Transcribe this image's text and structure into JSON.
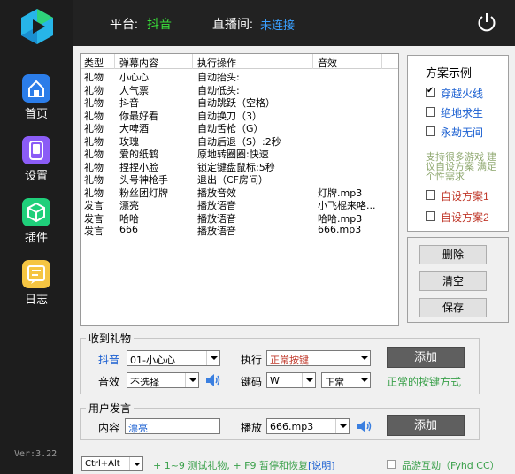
{
  "sidebar": {
    "items": [
      {
        "label": "首页",
        "icon": "home-icon",
        "color": "#2b7de9"
      },
      {
        "label": "设置",
        "icon": "settings-icon",
        "color": "#8b5cf6"
      },
      {
        "label": "插件",
        "icon": "plugin-icon",
        "color": "#1fcf7a"
      },
      {
        "label": "日志",
        "icon": "log-icon",
        "color": "#f5c542"
      }
    ],
    "version": "Ver:3.22"
  },
  "header": {
    "platform_label": "平台:",
    "platform_value": "抖音",
    "live_label": "直播间:",
    "live_value": "未连接"
  },
  "list": {
    "columns": [
      "类型",
      "弹幕内容",
      "执行操作",
      "音效"
    ],
    "rows": [
      [
        "礼物",
        "小心心",
        "自动抬头:",
        ""
      ],
      [
        "礼物",
        "人气票",
        "自动低头:",
        ""
      ],
      [
        "礼物",
        "抖音",
        "自动跳跃（空格）",
        ""
      ],
      [
        "礼物",
        "你最好看",
        "自动换刀（3）",
        ""
      ],
      [
        "礼物",
        "大啤酒",
        "自动舌枪（G）",
        ""
      ],
      [
        "礼物",
        "玫瑰",
        "自动后退（S）:2秒",
        ""
      ],
      [
        "礼物",
        "爱的纸鹤",
        "原地转圈圈:快速",
        ""
      ],
      [
        "礼物",
        "捏捏小脸",
        "锁定键盘鼠标:5秒",
        ""
      ],
      [
        "礼物",
        "头号神枪手",
        "退出（CF房间）",
        ""
      ],
      [
        "礼物",
        "粉丝团灯牌",
        "播放音效",
        "灯牌.mp3"
      ],
      [
        "发言",
        "漂亮",
        "播放语音",
        "小飞棍来咯..."
      ],
      [
        "发言",
        "哈哈",
        "播放语音",
        "哈哈.mp3"
      ],
      [
        "发言",
        "666",
        "播放语音",
        "666.mp3"
      ]
    ]
  },
  "scheme": {
    "title": "方案示例",
    "options": [
      {
        "label": "穿越火线",
        "checked": true,
        "color": "#1a5fd1"
      },
      {
        "label": "绝地求生",
        "checked": false,
        "color": "#1a5fd1"
      },
      {
        "label": "永劫无间",
        "checked": false,
        "color": "#1a5fd1"
      }
    ],
    "note": "支持很多游戏 建议自设方案 满足个性需求",
    "custom": [
      {
        "label": "自设方案1",
        "checked": false,
        "color": "#c0392b"
      },
      {
        "label": "自设方案2",
        "checked": false,
        "color": "#c0392b"
      }
    ]
  },
  "actions": {
    "delete": "删除",
    "clear": "清空",
    "save": "保存"
  },
  "gift": {
    "title": "收到礼物",
    "platform_label": "抖音",
    "gift_value": "01-小心心",
    "exec_label": "执行",
    "exec_value": "正常按键",
    "add": "添加",
    "sound_label": "音效",
    "sound_value": "不选择",
    "key_label": "键码",
    "key_value": "W",
    "mode_value": "正常",
    "hint": "正常的按键方式"
  },
  "speech": {
    "title": "用户发言",
    "content_label": "内容",
    "content_value": "漂亮",
    "play_label": "播放",
    "play_value": "666.mp3",
    "add": "添加"
  },
  "status": {
    "hotkey": "Ctrl+Alt",
    "text": "+ 1~9 测试礼物, + F9 暂停和恢复",
    "help": "[说明]",
    "brand": "品游互动（Fyhd CC）"
  }
}
